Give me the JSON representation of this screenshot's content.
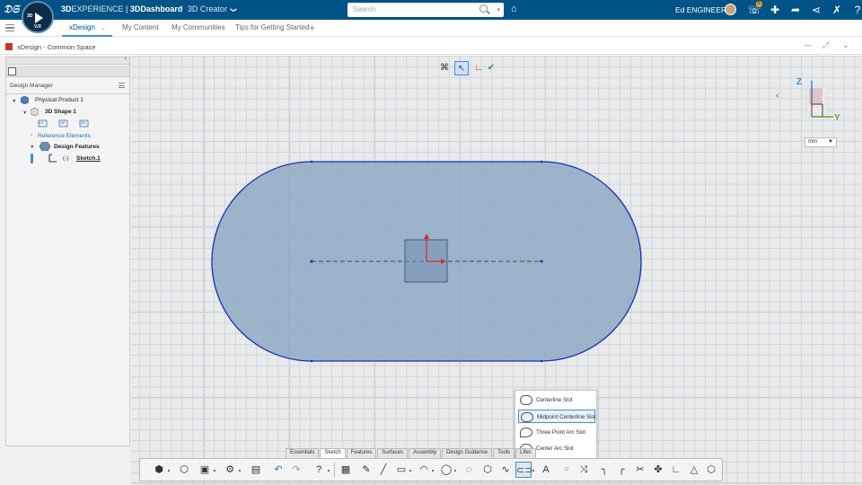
{
  "topbar": {
    "brand": "3D",
    "brand_suffix": "EXPERIENCE",
    "separator": " | ",
    "dashboard": "3DDashboard",
    "role": "3D Creator",
    "role_dropdown": "❯",
    "search_placeholder": "Search",
    "user_name": "Ed ENGINEER",
    "notification_count": "5",
    "compass": {
      "north": "3D",
      "south": "V.R",
      "west": "",
      "east": ""
    }
  },
  "tabs": [
    {
      "label": "xDesign",
      "active": true,
      "has_dropdown": true
    },
    {
      "label": "My Content"
    },
    {
      "label": "My Communities"
    },
    {
      "label": "Tips for Getting Started"
    }
  ],
  "panel": {
    "title": "xDesign - Common Space"
  },
  "tree": {
    "header": "Design Manager",
    "nodes": [
      {
        "label": "Physical Product 1"
      },
      {
        "label": "3D Shape 1"
      },
      {
        "label": "Reference Elements"
      },
      {
        "label": "Design Features"
      },
      {
        "label": "(-)"
      },
      {
        "label": "Sketch.1"
      }
    ],
    "plane_labels": [
      "XY",
      "YZ",
      "ZX"
    ]
  },
  "viewport": {
    "axis_labels": {
      "z": "Z",
      "y": "Y"
    },
    "unit": "mm"
  },
  "flyout": {
    "items": [
      {
        "label": "Centerline Slot"
      },
      {
        "label": "Midpoint Centerline Slot",
        "selected": true
      },
      {
        "label": "Three Point Arc Slot"
      },
      {
        "label": "Center Arc Slot"
      }
    ]
  },
  "workbench_tabs": [
    {
      "label": "Essentials"
    },
    {
      "label": "Sketch",
      "active": true
    },
    {
      "label": "Features"
    },
    {
      "label": "Surfaces"
    },
    {
      "label": "Assembly"
    },
    {
      "label": "Design Guidance"
    },
    {
      "label": "Tools"
    },
    {
      "label": "Lifec"
    }
  ],
  "colors": {
    "topbar": "#005386",
    "accent": "#3e8ddd",
    "slot_fill": "#8fa9c4",
    "slot_stroke": "#1a2fb8",
    "axis_red": "#e3262d",
    "axis_green": "#5ca52d"
  }
}
